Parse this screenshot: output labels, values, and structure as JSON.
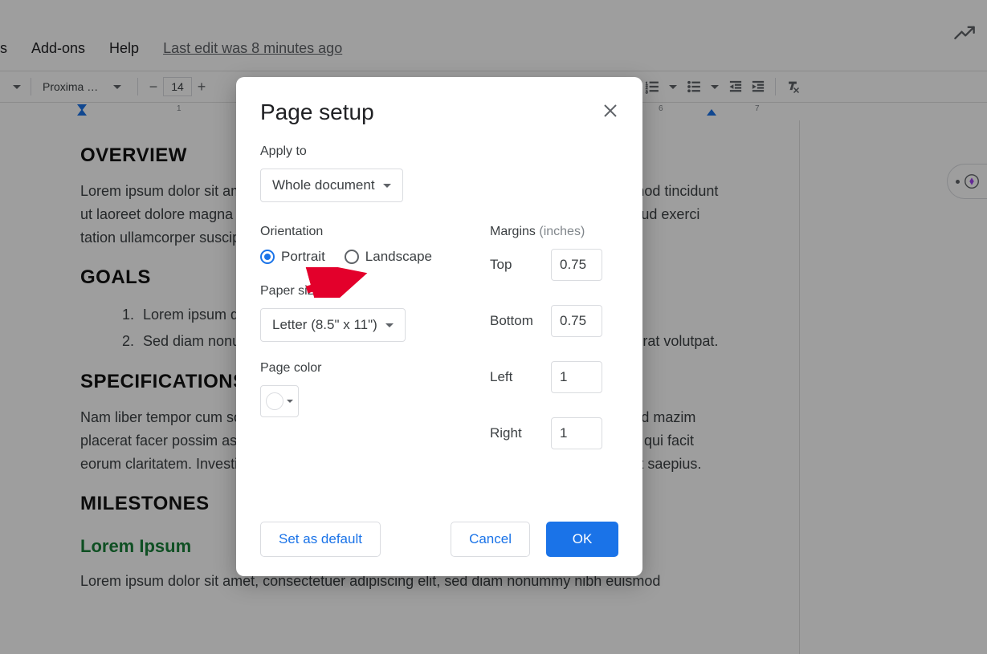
{
  "menubar": {
    "tools_partial": "s",
    "addons": "Add-ons",
    "help": "Help",
    "last_edit": "Last edit was 8 minutes ago"
  },
  "toolbar": {
    "font_name": "Proxima N…",
    "font_size": "14"
  },
  "ruler": {
    "marks": [
      "1",
      "6",
      "7"
    ]
  },
  "doc": {
    "h_overview": "Overview",
    "p_overview": "Lorem ipsum dolor sit amet, consectetuer adipiscing elit, sed diam nonummy nibh euismod tincidunt ut laoreet dolore magna aliquam erat volutpat. Ut wisi enim ad minim veniam, quis nostrud exerci tation ullamcorper suscipit lobortis nisl ut aliquip ex ea commodo consequat.",
    "h_goals": "Goals",
    "goal1": "Lorem ipsum dolor sit amet, consectetuer adipiscing elit.",
    "goal2": "Sed diam nonummy nibh euismod tincidunt ut laoreet dolore magna aliquam erat volutpat.",
    "h_specs": "Specifications",
    "p_specs": "Nam liber tempor cum soluta nobis eleifend option congue nihil imperdiet doming id quod mazim placerat facer possim assum. Typi non habent claritatem insitam; est usus legentis in iis qui facit eorum claritatem. Investigationes demonstraverunt lectores legere me lius quod ii legunt saepius.",
    "h_milestones": "Milestones",
    "h_green": "Lorem Ipsum",
    "p_last": "Lorem ipsum dolor sit amet, consectetuer adipiscing elit, sed diam nonummy nibh euismod"
  },
  "dialog": {
    "title": "Page setup",
    "apply_to_label": "Apply to",
    "apply_to_value": "Whole document",
    "orientation_label": "Orientation",
    "portrait": "Portrait",
    "landscape": "Landscape",
    "paper_size_label": "Paper size",
    "paper_size_value": "Letter (8.5\" x 11\")",
    "page_color_label": "Page color",
    "margins_label": "Margins",
    "margins_unit": "(inches)",
    "margin_top_label": "Top",
    "margin_top_value": "0.75",
    "margin_bottom_label": "Bottom",
    "margin_bottom_value": "0.75",
    "margin_left_label": "Left",
    "margin_left_value": "1",
    "margin_right_label": "Right",
    "margin_right_value": "1",
    "set_default": "Set as default",
    "cancel": "Cancel",
    "ok": "OK"
  }
}
